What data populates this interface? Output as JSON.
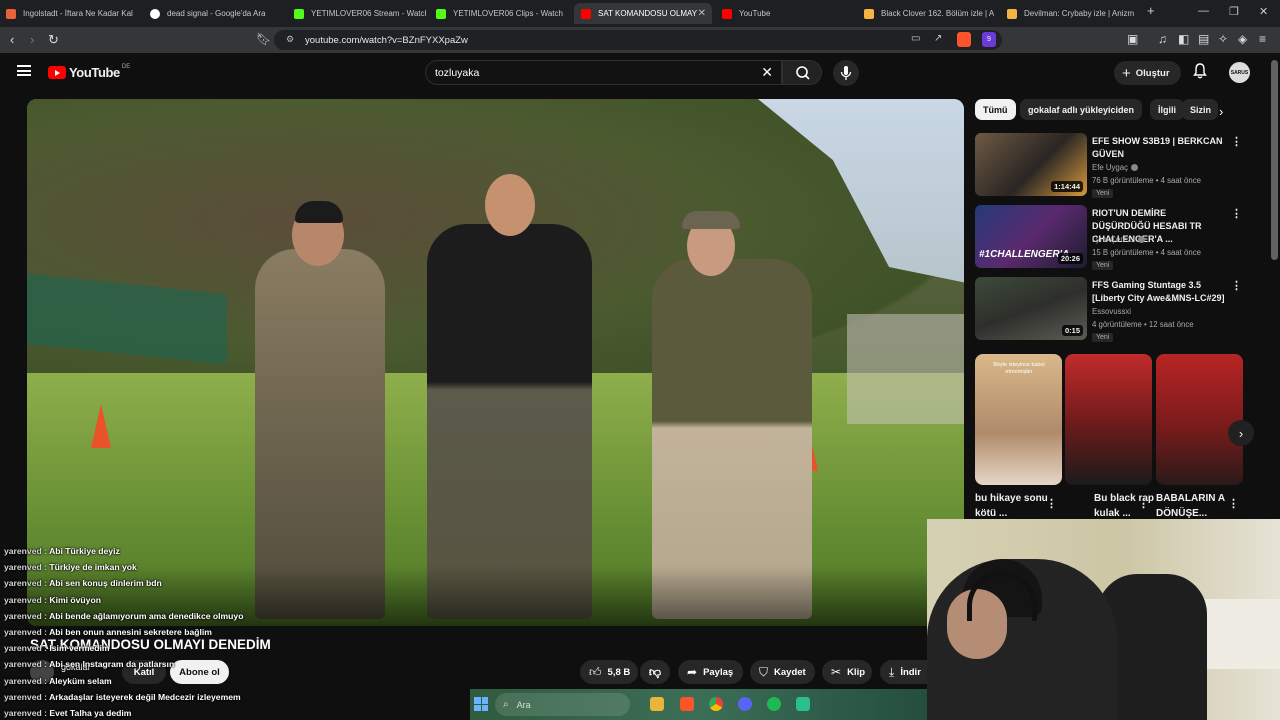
{
  "browser": {
    "tabs": [
      {
        "title": "Ingolstadt - İftara Ne Kadar Kal",
        "color": "#e8623a"
      },
      {
        "title": "dead signal - Google'da Ara",
        "color": "#ffffff"
      },
      {
        "title": "YETIMLOVER06 Stream - Watch",
        "color": "#53fc18"
      },
      {
        "title": "YETIMLOVER06 Clips - Watch L",
        "color": "#53fc18"
      },
      {
        "title": "SAT KOMANDOSU OLMAY",
        "color": "#ff0000"
      },
      {
        "title": "YouTube",
        "color": "#ff0000"
      },
      {
        "title": "Black Clover 162. Bölüm izle | A",
        "color": "#f5b342"
      },
      {
        "title": "Devilman: Crybaby izle | Anizm",
        "color": "#f5b342"
      }
    ],
    "url": "youtube.com/watch?v=BZnFYXXpaZw",
    "brave_badge": "9"
  },
  "youtube": {
    "logo_text": "YouTube",
    "country_code": "DE",
    "search_query": "tozluyaka",
    "create_label": "Oluştur",
    "avatar_text": "SARUS"
  },
  "video": {
    "title": "SAT KOMANDOSU OLMAYI DENEDİM",
    "channel": "gokalaf",
    "join_label": "Katıl",
    "subscribe_label": "Abone ol",
    "likes": "5,8 B",
    "share_label": "Paylaş",
    "save_label": "Kaydet",
    "clip_label": "Klip",
    "download_label": "İndir"
  },
  "chat": [
    {
      "user": "yarenved",
      "msg": "Abi Türkiye deyiz"
    },
    {
      "user": "yarenved",
      "msg": "Türkiye de imkan yok"
    },
    {
      "user": "yarenved",
      "msg": "Abi sen konuş dinlerim bdn"
    },
    {
      "user": "yarenved",
      "msg": "Kimi övüyon"
    },
    {
      "user": "yarenved",
      "msg": "Abi bende ağlamıyorum ama denedikce olmuyo"
    },
    {
      "user": "yarenved",
      "msg": "Abi ben onun annesini sekretere bağlim"
    },
    {
      "user": "yarenved",
      "msg": "Isim vermedim"
    },
    {
      "user": "yarenved",
      "msg": "Abi sen Instagram da patlarsın"
    },
    {
      "user": "yarenved",
      "msg": "Aleyküm selam"
    },
    {
      "user": "yarenved",
      "msg": "Arkadaşlar isteyerek değil Medcezir izleyemem"
    },
    {
      "user": "yarenved",
      "msg": "Evet Talha ya dedim"
    }
  ],
  "sidebar": {
    "chips": [
      "Tümü",
      "gokalaf adlı yükleyiciden",
      "İlgili",
      "Sizin"
    ],
    "recommendations": [
      {
        "title": "EFE SHOW S3B19 | BERKCAN GÜVEN",
        "channel": "Efe Uygaç",
        "meta": "76 B görüntüleme • 4 saat önce",
        "badge": "Yeni",
        "duration": "1:14:44"
      },
      {
        "title": "RIOT'UN DEMİRE DÜŞÜRDÜĞÜ HESABI TR CHALLENGER'A ...",
        "channel": "Lynx Çerezz",
        "meta": "15 B görüntüleme • 4 saat önce",
        "badge": "Yeni",
        "duration": "20:26",
        "thumb_text": "#1CHALLENGER'A"
      },
      {
        "title": "FFS Gaming Stuntage 3.5 [Liberty City Awe&MNS-LC#29]",
        "channel": "Essovussxi",
        "meta": "4 görüntüleme • 12 saat önce",
        "badge": "Yeni",
        "duration": "0:15"
      }
    ],
    "shorts": [
      {
        "title": "bu hikaye sonu kötü ...",
        "thumb_text": "Böyle isteyince kabul etmemişler"
      },
      {
        "title": "Bu black rap kulak ..."
      },
      {
        "title": "BABALARIN A DÖNÜŞE..."
      }
    ]
  },
  "taskbar": {
    "search_label": "Ara"
  },
  "colors": {
    "accent": "#ff0000",
    "background": "#0f0f0f",
    "chip_active": "#f1f1f1",
    "kick_green": "#53fc18"
  }
}
